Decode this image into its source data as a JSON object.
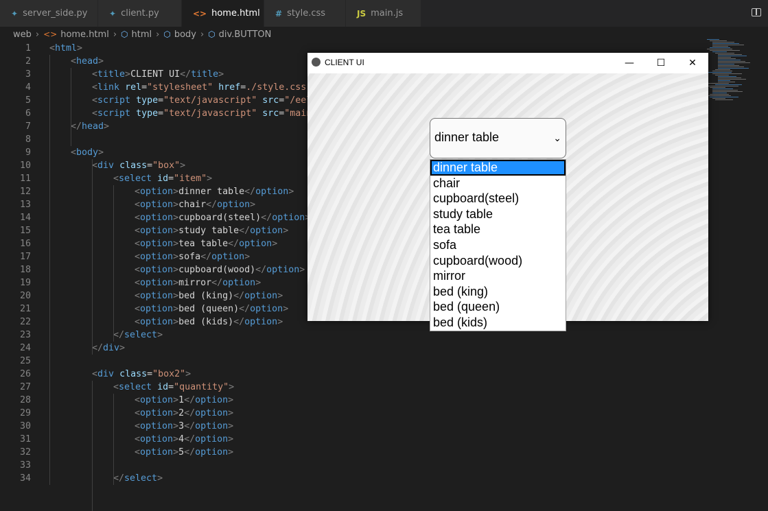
{
  "tabs": [
    {
      "icon": "python-icon",
      "label": "server_side.py",
      "active": false
    },
    {
      "icon": "python-icon",
      "label": "client.py",
      "active": false
    },
    {
      "icon": "html-icon",
      "label": "home.html",
      "active": true,
      "close": "✕"
    },
    {
      "icon": "css-icon",
      "label": "style.css",
      "active": false
    },
    {
      "icon": "js-icon",
      "label": "main.js",
      "active": false
    }
  ],
  "tab_icon_glyphs": {
    "python": "✦",
    "html": "<>",
    "css": "#",
    "js": "JS"
  },
  "breadcrumb": [
    "web",
    "home.html",
    "html",
    "body",
    "div.BUTTON"
  ],
  "code_lines": [
    "<html>",
    "<head>",
    "<title>CLIENT UI</title>",
    "<link rel=\"stylesheet\" href=./style.css t",
    "<script type=\"text/javascript\" src=\"/eel.",
    "<script type=\"text/javascript\" src=\"main.",
    "</head>",
    "",
    "<body>",
    "<div class=\"box\">",
    "<select id=\"item\">",
    "<option>dinner table</option>",
    "<option>chair</option>",
    "<option>cupboard(steel)</option>",
    "<option>study table</option>",
    "<option>tea table</option>",
    "<option>sofa</option>",
    "<option>cupboard(wood)</option>",
    "<option>mirror</option>",
    "<option>bed (king)</option>",
    "<option>bed (queen)</option>",
    "<option>bed (kids)</option>",
    "</select>",
    "</div>",
    "",
    "<div class=\"box2\">",
    "<select id=\"quantity\">",
    "<option>1</option>",
    "<option>2</option>",
    "<option>3</option>",
    "<option>4</option>",
    "<option>5</option>",
    "",
    "</select>"
  ],
  "client_window": {
    "title": "CLIENT UI",
    "minimize": "—",
    "maximize": "☐",
    "close": "✕",
    "selected_value": "dinner table",
    "options": [
      "dinner table",
      "chair",
      "cupboard(steel)",
      "study table",
      "tea table",
      "sofa",
      "cupboard(wood)",
      "mirror",
      "bed (king)",
      "bed (queen)",
      "bed (kids)"
    ]
  },
  "colors": {
    "editor_bg": "#1e1e1e",
    "tag": "#569cd6",
    "attr": "#9cdcfe",
    "string": "#ce9178",
    "selection": "#1e90ff"
  }
}
